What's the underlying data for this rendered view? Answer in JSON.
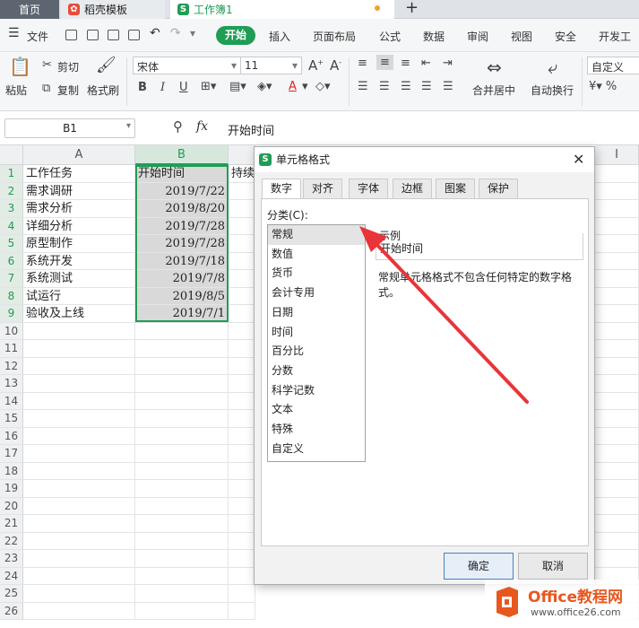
{
  "tabs": {
    "home": "首页",
    "template": "稻壳模板",
    "workbook": "工作簿1"
  },
  "menu": {
    "file": "文件",
    "items": [
      "开始",
      "插入",
      "页面布局",
      "公式",
      "数据",
      "审阅",
      "视图",
      "安全",
      "开发工"
    ]
  },
  "ribbon": {
    "paste": "粘贴",
    "cut": "剪切",
    "copy": "复制",
    "format_painter": "格式刷",
    "font_name": "宋体",
    "font_size": "11",
    "merge_center": "合并居中",
    "wrap_text": "自动换行",
    "number_format": "自定义"
  },
  "formula_bar": {
    "cell_ref": "B1",
    "fx": "fx",
    "content": "开始时间"
  },
  "sheet": {
    "col_a": "A",
    "col_b": "B",
    "col_i": "I",
    "c1_partial": "持续",
    "row_numbers": [
      "1",
      "2",
      "3",
      "4",
      "5",
      "6",
      "7",
      "8",
      "9",
      "10",
      "11",
      "12",
      "13",
      "14",
      "15",
      "16",
      "17",
      "18",
      "19",
      "20",
      "21",
      "22",
      "23",
      "24",
      "25",
      "26"
    ],
    "a_values": [
      "工作任务",
      "需求调研",
      "需求分析",
      "详细分析",
      "原型制作",
      "系统开发",
      "系统测试",
      "试运行",
      "验收及上线"
    ],
    "b_values": [
      "开始时间",
      "2019/7/22",
      "2019/8/20",
      "2019/7/28",
      "2019/7/28",
      "2019/7/18",
      "2019/7/8",
      "2019/8/5",
      "2019/7/1"
    ]
  },
  "dialog": {
    "title": "单元格格式",
    "tabs": [
      "数字",
      "对齐",
      "字体",
      "边框",
      "图案",
      "保护"
    ],
    "category_label": "分类(C):",
    "categories": [
      "常规",
      "数值",
      "货币",
      "会计专用",
      "日期",
      "时间",
      "百分比",
      "分数",
      "科学记数",
      "文本",
      "特殊",
      "自定义"
    ],
    "selected_category": "常规",
    "sample_label": "示例",
    "sample_value": "开始时间",
    "description": "常规单元格格式不包含任何特定的数字格式。",
    "ok": "确定",
    "cancel": "取消"
  },
  "watermark": {
    "brand": "Office教程网",
    "url": "www.office26.com"
  },
  "colors": {
    "accent_green": "#1f9d55",
    "arrow_red": "#e8353a",
    "watermark_orange": "#e8571e"
  }
}
